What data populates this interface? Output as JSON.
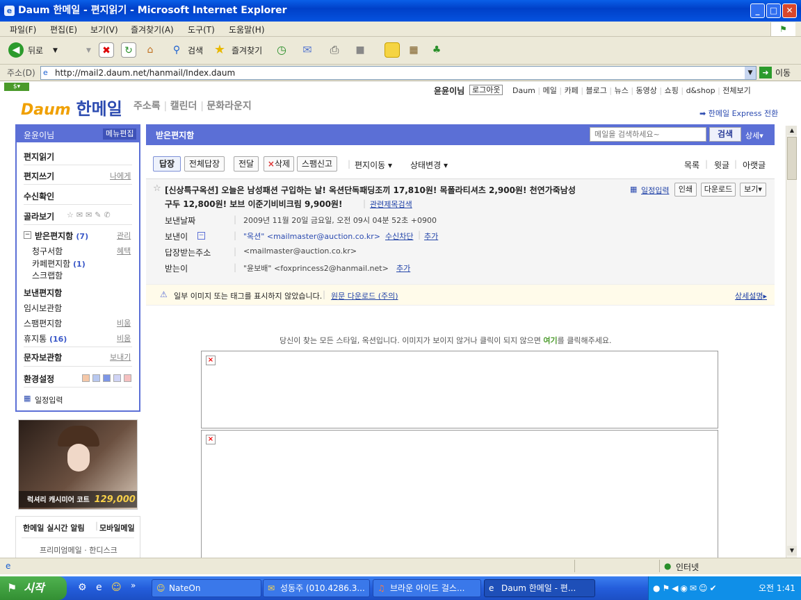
{
  "window": {
    "title": "Daum 한메일 - 편지읽기 - Microsoft Internet Explorer"
  },
  "menu": [
    "파일(F)",
    "편집(E)",
    "보기(V)",
    "즐겨찾기(A)",
    "도구(T)",
    "도움말(H)"
  ],
  "toolbar": {
    "back": "뒤로",
    "search": "검색",
    "favorites": "즐겨찾기"
  },
  "address": {
    "label": "주소(D)",
    "url": "http://mail2.daum.net/hanmail/Index.daum",
    "go": "이동"
  },
  "header": {
    "user": "윤윤이님",
    "logout": "로그아웃",
    "nav": [
      "Daum",
      "메일",
      "카페",
      "블로그",
      "뉴스",
      "동영상",
      "쇼핑",
      "d&shop",
      "전체보기"
    ],
    "logo_brand": "Daum",
    "logo_title": "한메일",
    "subnav": [
      "주소록",
      "캘린더",
      "문화라운지"
    ],
    "express": "한메일 Express 전환"
  },
  "sidebar": {
    "user": "윤윤이님",
    "menu_edit": "메뉴편집",
    "read": "편지읽기",
    "write": "편지쓰기",
    "to_me": "나에게",
    "receipt": "수신확인",
    "filter": "골라보기",
    "inbox": "받은편지함",
    "inbox_count": "(7)",
    "inbox_manage": "관리",
    "billing": "청구서함",
    "billing_benefit": "혜택",
    "cafe": "카페편지함",
    "cafe_count": "(1)",
    "scrap": "스크랩함",
    "sent": "보낸편지함",
    "draft": "임시보관함",
    "spam": "스팸편지함",
    "spam_empty": "비움",
    "trash": "휴지통",
    "trash_count": "(16)",
    "trash_empty": "비움",
    "sms": "문자보관함",
    "sms_send": "보내기",
    "settings": "환경설정",
    "schedule": "일정입력",
    "ad_text": "럭셔리 캐시미어 코트",
    "ad_price": "129,000",
    "alert": "한메일 실시간 알림",
    "mobile": "모바일메일",
    "premium": "프리미엄메일 · 한디스크",
    "theme_colors": [
      "#f5c8a8",
      "#b8c8f0",
      "#7d96e6",
      "#d0d4f5",
      "#f5c0c0"
    ]
  },
  "mailbar": {
    "folder": "받은편지함",
    "search_placeholder": "메일을 검색하세요~",
    "search_btn": "검색",
    "detail": "상세"
  },
  "actions": {
    "reply": "답장",
    "reply_all": "전체답장",
    "forward": "전달",
    "delete": "삭제",
    "spam": "스팸신고",
    "move": "편지이동",
    "status": "상태변경",
    "list": "목록",
    "prev": "윗글",
    "next": "아랫글"
  },
  "message": {
    "subject_line1": "[신상특구옥션] 오늘은 남성패션 구입하는 날! 옥션단독패딩조끼 17,810원! 목폴라티셔츠 2,900원! 천연가죽남성",
    "subject_line2": "구두 12,800원! 보브 이준기비비크림 9,900원!",
    "related": "관련제목검색",
    "schedule": "일정입력",
    "print": "인쇄",
    "download": "다운로드",
    "view": "보기",
    "date_label": "보낸날짜",
    "date": "2009년 11월 20일 금요일, 오전 09시 04분 52초 +0900",
    "from_label": "보낸이",
    "from": "\"옥션\" <mailmaster@auction.co.kr>",
    "block": "수신차단",
    "add": "추가",
    "replyto_label": "답장받는주소",
    "replyto": "<mailmaster@auction.co.kr>",
    "to_label": "받는이",
    "to": "\"윤보배\" <foxprincess2@hanmail.net>",
    "add2": "추가",
    "notice": "일부 이미지 또는 태그를 표시하지 않았습니다.",
    "notice_link": "원문 다운로드 (주의)",
    "notice_detail": "상세설명",
    "body_pre": "당신이 찾는 모든 스타일, 옥션입니다. 이미지가 보이지 않거나 클릭이 되지 않으면 ",
    "body_link": "여기",
    "body_post": "를 클릭해주세요."
  },
  "status": {
    "zone": "인터넷"
  },
  "taskbar": {
    "start": "시작",
    "tasks": [
      "NateOn",
      "성동주 (010.4286.3...",
      "브라운 아이드 걸스...",
      "Daum 한메일 - 편..."
    ],
    "clock": "오전 1:41"
  }
}
